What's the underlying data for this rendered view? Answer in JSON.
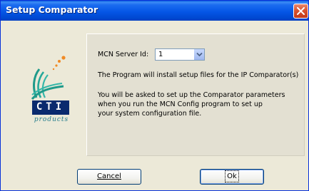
{
  "window": {
    "title": "Setup Comparator"
  },
  "logo": {
    "brand": "CTI",
    "tagline": "products"
  },
  "form": {
    "server_id_label": "MCN Server Id:",
    "server_id_value": "1",
    "install_message": "The Program will install setup files for the IP Comparator(s)",
    "info_lines": [
      "You will be asked to set up the Comparator parameters",
      "when you run the MCN Config program to set up",
      "your system configuration file."
    ]
  },
  "buttons": {
    "cancel_label": "Cancel",
    "ok_label": "Ok"
  },
  "colors": {
    "titlebar": "#0556e6",
    "close_button": "#d9532f",
    "dialog_bg": "#ece9d8",
    "logo_teal": "#1f9a8a",
    "logo_navy": "#0a2a6e",
    "logo_orange": "#f08a24"
  },
  "icons": {
    "close": "close-icon",
    "dropdown": "chevron-down-icon"
  }
}
